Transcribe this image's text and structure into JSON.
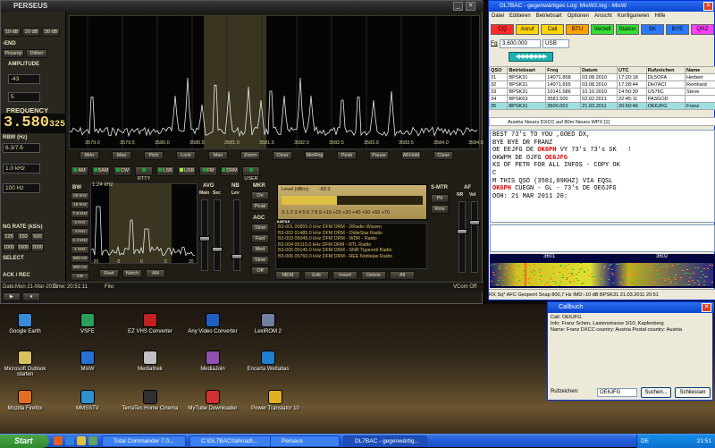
{
  "perseus": {
    "title": "PERSEUS",
    "left_panel": {
      "zoom_buttons": [
        "10 dB",
        "20 dB",
        "30 dB"
      ],
      "section_front_end": "-END",
      "front_end_buttons": [
        "Preamp",
        "Dither"
      ],
      "section_amplitude": "AMPLITUDE",
      "amplitude_value": "-43",
      "value2": "5",
      "section_frequency": "FREQUENCY",
      "frequency_main": "3.580",
      "frequency_sub": "325",
      "rbw_label": "RBW (Hz)",
      "rbw_value": "6.3/7.6",
      "span_label": "1.0 kHz",
      "step_label": "100 Hz",
      "section_sampling": "NG RATE (kS/s)",
      "sampling_rates": [
        "125",
        "250",
        "500",
        "1000",
        "1600",
        "2000"
      ],
      "section_select": "SELECT",
      "section_rec": "ACK / REC",
      "date_label": "Date:",
      "date_value": "Mon 21-Mar-2011",
      "time_label": "Time:",
      "time_value": "20:51:11",
      "file_label": "File:"
    },
    "spectrum_freq_labels": [
      "3579.0",
      "3579.5",
      "3580.0",
      "3580.5",
      "3581.0",
      "3581.5",
      "3582.0",
      "3582.5",
      "3583.0",
      "3583.5",
      "3584.0",
      "3584.5"
    ],
    "spectrum_buttons": [
      "Mrkr",
      "Max",
      "Ptch",
      "Lock",
      "Max",
      "Zoom",
      "Clear",
      "MinRng",
      "Peak",
      "Pause",
      "AFHold",
      "Clear"
    ],
    "mode_buttons": [
      {
        "label": "AM",
        "on": false
      },
      {
        "label": "SAM",
        "on": false
      },
      {
        "label": "CW",
        "on": false
      },
      {
        "label": "RTTY",
        "on": false
      },
      {
        "label": "LSB",
        "on": false
      },
      {
        "label": "USB",
        "on": true
      },
      {
        "label": "FM",
        "on": false
      },
      {
        "label": "DRM",
        "on": false
      },
      {
        "label": "USER",
        "on": false
      }
    ],
    "bw_label": "BW",
    "bw_value": "1.24 kHz",
    "bw_buttons": [
      "25 kHz",
      "15 kHz",
      "7.5 kHz",
      "5 kHz",
      "3 kHz",
      "2.4 kHz",
      "1 kHz",
      "500 Hz",
      "300 Hz",
      "DB"
    ],
    "bw_axis": [
      "-20",
      "-5",
      "0",
      "5",
      "20"
    ],
    "filter_buttons": [
      "Rset",
      "Notch",
      "AN"
    ],
    "avg_label": "AVG",
    "avg_sub": [
      "Main",
      "Sec"
    ],
    "nb_label": "NB",
    "nb_sub": "Lev",
    "mkr_label": "MKR",
    "mkr_buttons": [
      "On",
      "Peak"
    ],
    "agc_label": "AGC",
    "agc_buttons": [
      "Slow",
      "Fast",
      "Med",
      "Slow",
      "Off"
    ],
    "meter": {
      "level_label": "Level (dBm):",
      "level_value": "-83.3",
      "scale": "S 1 2 3 4 5 6 7 8 9 +10 +20 +30 +40 +50 +60 +70"
    },
    "smtr_label": "S-MTR",
    "smtr_buttons": [
      "Pk",
      "Rms"
    ],
    "af_label": "AF",
    "af_sub": [
      "NR",
      "Vol"
    ],
    "mem_title": "MEM",
    "mem_items": [
      "B3-001 00855.0 kHz DFM  DRM - DRadio Wissen",
      "B3-002 01485.0 kHz DFM  DRM - OldieStar Radio",
      "B3-003 05045.0 kHz DFM  DRM - WDR - Radio",
      "B3-004 05115.0 kHz DFM  DRM - RTL Radio",
      "B3-005 05145.0 kHz DFM  DRM - SNR Tigaresti Radio",
      "B3-006 05760.0 kHz DFM  DRM - REE Noblejas Radio"
    ],
    "mem_buttons": [
      "MEM",
      "Edit",
      "Insert",
      "Delete",
      "All"
    ],
    "vcom_status": "VCom Off"
  },
  "mixw": {
    "title": "DL7BAC - gegenwärtiges Log: MixW2.log - MixW",
    "menu": [
      "Datei",
      "Editieren",
      "Betriebsart",
      "Optionen",
      "Ansicht",
      "Konfigurieren",
      "Hilfe"
    ],
    "macro_buttons": [
      {
        "label": "CQ",
        "color": "#ff2a2a"
      },
      {
        "label": "Anruf",
        "color": "#ffd400"
      },
      {
        "label": "Call",
        "color": "#ffd400"
      },
      {
        "label": "BTU",
        "color": "#ffa200"
      },
      {
        "label": "Verzell",
        "color": "#33dd33"
      },
      {
        "label": "Station",
        "color": "#33dd33"
      },
      {
        "label": "SK",
        "color": "#2a7aff"
      },
      {
        "label": "BYE",
        "color": "#2a7aff"
      },
      {
        "label": "QRZ",
        "color": "#ff40ff"
      }
    ],
    "freq_label": "Fq",
    "freq_value": "3.600.000",
    "mode_value": "USB",
    "log_headers": [
      "QSO",
      "Betriebsart",
      "Freq",
      "Datum",
      "UTC",
      "Rufzeichen",
      "Name"
    ],
    "log_rows": [
      [
        "31",
        "BPSK31",
        "14071.858",
        "03.08.2010",
        "17:20:18",
        "DL5OFA",
        "Herbert"
      ],
      [
        "32",
        "BPSK31",
        "14071.655",
        "03.08.2010",
        "17:28:44",
        "DH7ACI",
        "Reinhard"
      ],
      [
        "33",
        "BPSK31",
        "10141.586",
        "10.10.2010",
        "14:50:39",
        "US7IIC",
        "Steve"
      ],
      [
        "34",
        "BPSK63",
        "3581.500",
        "02.02.2011",
        "22:45:11",
        "PA3GOD",
        ""
      ],
      [
        "35",
        "BPSK31",
        "3600.001",
        "21.03.2011",
        "20:50:46",
        "OE6JFG",
        "Franz"
      ]
    ],
    "dxcc_line": "Austria  Neues DXCC auf 80m Neues WPX [1]",
    "rx_lines": [
      {
        "text": "BEST 73's TO YOU ,GOED DX,",
        "hl": ""
      },
      {
        "text": "BYE BYE DR FRANZ",
        "hl": ""
      },
      {
        "text": "OE EEJFG DE ",
        "hl": "OK6PH",
        "tail": " VY 73's 73's SK   !"
      },
      {
        "text": "OKWPM DE OJFG ",
        "hl": "OE6JFG",
        "tail": ""
      },
      {
        "text": "KS OF PETR FOR ALL INFOS - COPY OK",
        "hl": ""
      },
      {
        "text": "C",
        "hl": ""
      },
      {
        "text": "M THIS QSO (3581,09KHZ) VIA EQSL",
        "hl": ""
      },
      {
        "text": "",
        "hl": "OK6PH",
        "tail": " CUEGN - GL - 73's DE OE6JFG"
      },
      {
        "text": "OOH: 21 MAR 2011 20:",
        "hl": ""
      }
    ],
    "waterfall_labels": [
      "3601",
      "3602"
    ],
    "status_bar": "RX  Sq*  AFC  Gesperrt  Snap  800,7 Hz  IMD:-10 dB  BPSK31  21.03.2011  20:51"
  },
  "callbuch": {
    "title": "Callbuch",
    "call_line": "Call: OE6JFG",
    "info_line": "Info: Franz Schen, Lastenstrasse 3/10, Kapfenberg",
    "name_line": "Name: Franz  DXCC country: Austria  Postal country: Austria",
    "search_label": "Rufzeichen:",
    "search_value": "OE6JFG",
    "search_button": "Suchen...",
    "close_button": "Schliessen"
  },
  "desktop_icons": [
    {
      "label": "Google Earth",
      "color": "#3b8ad8"
    },
    {
      "label": "VSFE",
      "color": "#2aa05a"
    },
    {
      "label": "EZ VHS Converter",
      "color": "#c02020"
    },
    {
      "label": "Any Video Converter",
      "color": "#2060c0"
    },
    {
      "label": "LexiROM 2",
      "color": "#7080a0"
    },
    {
      "label": "Microsoft Outlook starten",
      "color": "#d8c060"
    },
    {
      "label": "MixW",
      "color": "#2a70d0"
    },
    {
      "label": "Mediathek",
      "color": "#c0c0c0"
    },
    {
      "label": "MediaJoin",
      "color": "#9050b0"
    },
    {
      "label": "Encarta Weltatlas",
      "color": "#2080d0"
    },
    {
      "label": "Mozilla Firefox",
      "color": "#e07020"
    },
    {
      "label": "MMSSTV",
      "color": "#3090d0"
    },
    {
      "label": "TerraTec Home Cinema",
      "color": "#303030"
    },
    {
      "label": "MyTube Downloader",
      "color": "#d03030"
    },
    {
      "label": "Power Translator 10",
      "color": "#e0b020"
    }
  ],
  "taskbar": {
    "start_label": "Start",
    "tasks": [
      {
        "label": "Total Commander 7.0...",
        "active": false
      },
      {
        "label": "C:\\DL7BAC\\fahrrad\\...",
        "active": false
      },
      {
        "label": "Perseus",
        "active": false
      },
      {
        "label": "DL7BAC - gegenwärtig...",
        "active": true
      }
    ],
    "locale": "DE",
    "clock": "21:51"
  }
}
